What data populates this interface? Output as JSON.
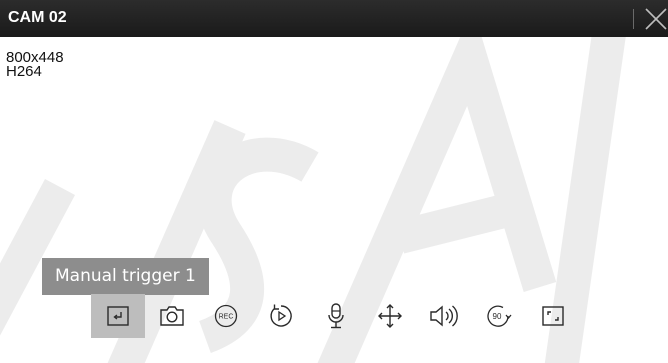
{
  "window": {
    "title": "CAM 02"
  },
  "stream": {
    "resolution": "800x448",
    "codec": "H264"
  },
  "watermark": {
    "text": "SAI"
  },
  "tooltip": {
    "text": "Manual trigger 1"
  },
  "toolbar": {
    "buttons": [
      {
        "icon": "manual-trigger-icon",
        "active": true
      },
      {
        "icon": "camera-icon",
        "active": false
      },
      {
        "icon": "record-icon",
        "label": "REC",
        "active": false
      },
      {
        "icon": "instant-playback-icon",
        "active": false
      },
      {
        "icon": "microphone-icon",
        "active": false
      },
      {
        "icon": "ptz-move-icon",
        "active": false
      },
      {
        "icon": "speaker-icon",
        "active": false
      },
      {
        "icon": "rotate-90-icon",
        "label": "90",
        "active": false
      },
      {
        "icon": "fullscreen-icon",
        "active": false
      }
    ]
  },
  "colors": {
    "titlebar": "#1f1f1f",
    "tooltip_bg": "#8d8d8d",
    "active_button_bg": "#bdbdbd",
    "icon_stroke": "#2a2a2a"
  }
}
